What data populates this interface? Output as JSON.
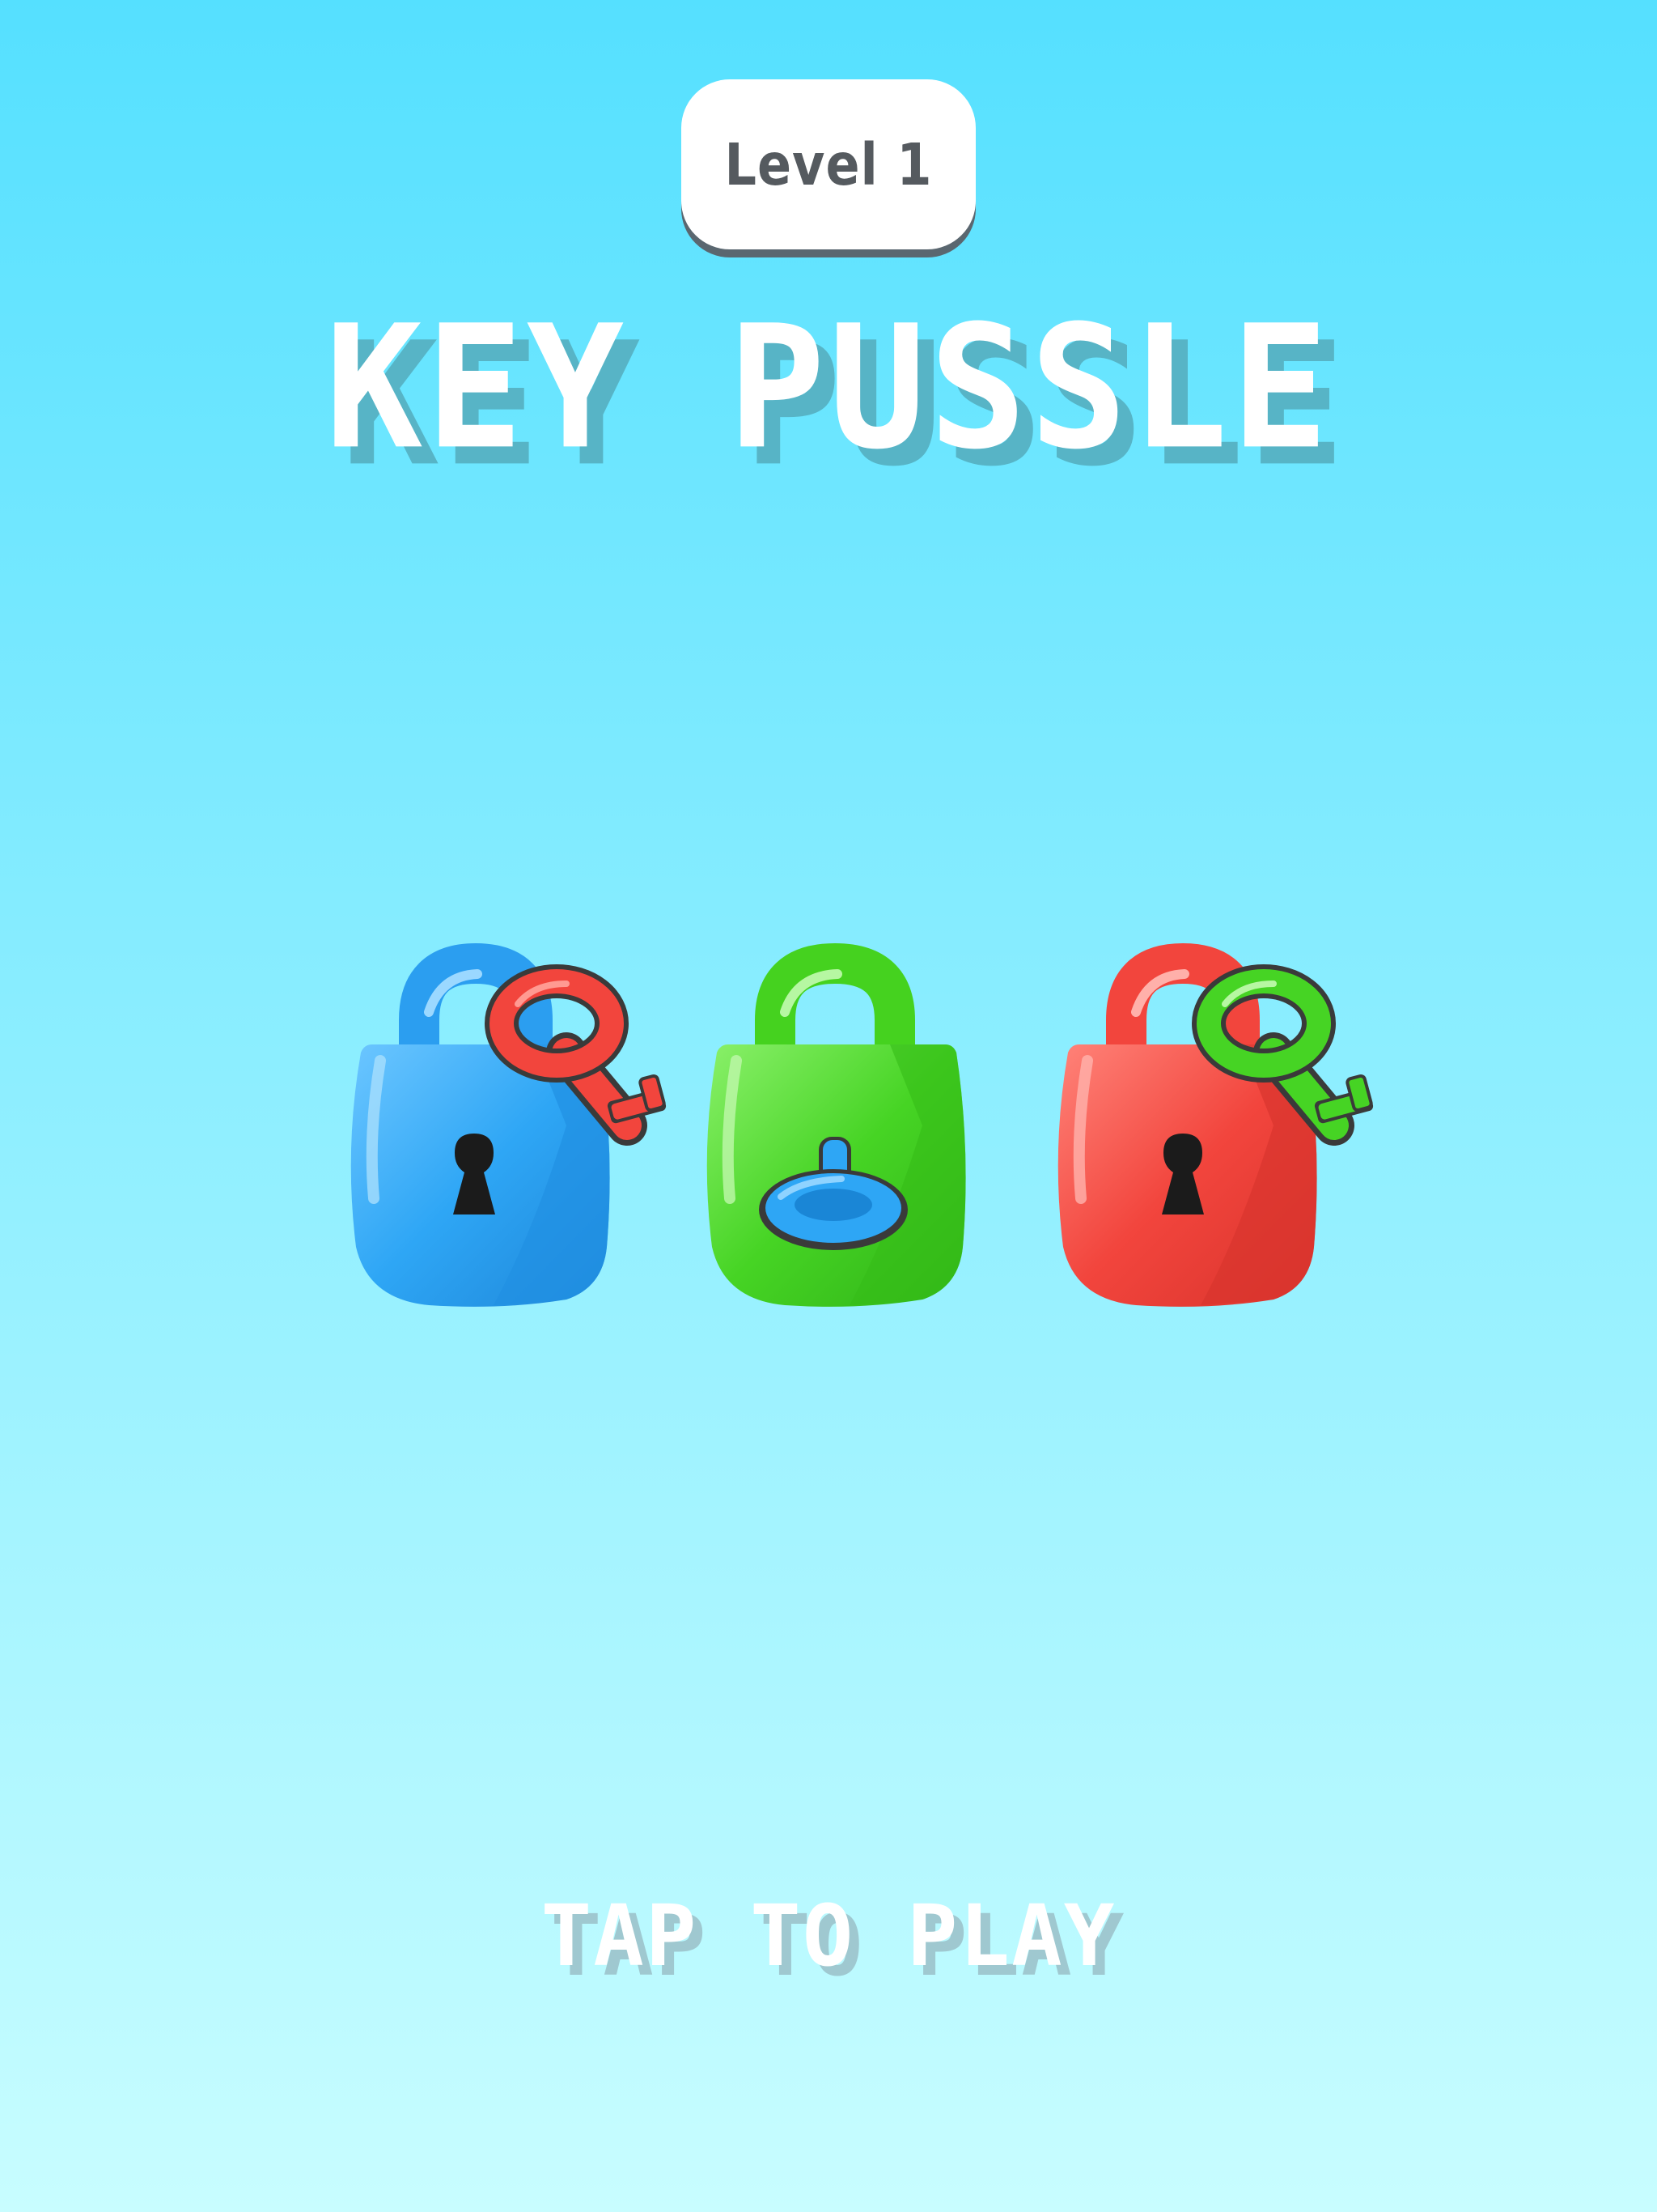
{
  "background": {
    "top_color": "#55e0ff",
    "bottom_color": "#c8fdff"
  },
  "level_badge": {
    "label": "Level 1"
  },
  "title": {
    "text": "KEY PUSSLE"
  },
  "prompt": {
    "text": "TAP TO PLAY"
  },
  "colors": {
    "blue": "#2ea6f5",
    "green": "#46d424",
    "red": "#f2453d",
    "keyhole": "#1b1b1b"
  },
  "locks": [
    {
      "name": "blue-padlock",
      "color": "blue",
      "state": "locked",
      "attached_key": "red"
    },
    {
      "name": "green-padlock",
      "color": "green",
      "state": "key-inserted",
      "attached_key": "blue"
    },
    {
      "name": "red-padlock",
      "color": "red",
      "state": "locked",
      "attached_key": "green"
    }
  ]
}
